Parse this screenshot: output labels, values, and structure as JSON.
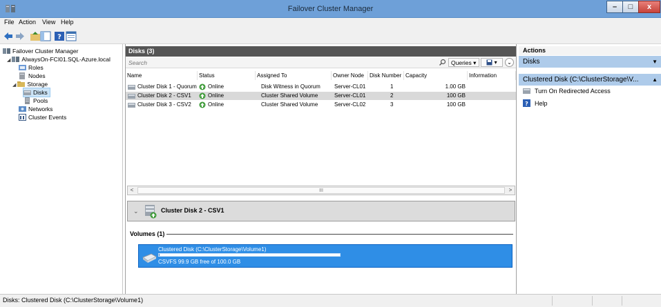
{
  "window": {
    "title": "Failover Cluster Manager",
    "minimize_glyph": "–",
    "maximize_glyph": "□",
    "close_glyph": "x"
  },
  "menu": {
    "items": [
      "File",
      "Action",
      "View",
      "Help"
    ]
  },
  "toolbar": {
    "icons": [
      "back-arrow-icon",
      "forward-arrow-icon",
      "up-folder-icon",
      "show-hide-tree-icon",
      "help-icon",
      "properties-icon"
    ]
  },
  "tree": {
    "root": "Failover Cluster Manager",
    "cluster": "AlwaysOn-FCI01.SQL-Azure.local",
    "roles": "Roles",
    "nodes": "Nodes",
    "storage": "Storage",
    "disks": "Disks",
    "pools": "Pools",
    "networks": "Networks",
    "cluster_events": "Cluster Events"
  },
  "center": {
    "header": "Disks (3)",
    "search_placeholder": "Search",
    "queries_label": "Queries ▾",
    "save_query_label": "▾",
    "collapse_glyph": "⌄",
    "columns": [
      "Name",
      "Status",
      "Assigned To",
      "Owner Node",
      "Disk Number",
      "Capacity",
      "Information"
    ],
    "rows": [
      {
        "name": "Cluster Disk 1 - Quorum",
        "status": "Online",
        "assigned": "Disk Witness in Quorum",
        "owner": "Server-CL01",
        "disk_number": "1",
        "capacity": "1.00 GB",
        "information": ""
      },
      {
        "name": "Cluster Disk 2 - CSV1",
        "status": "Online",
        "assigned": "Cluster Shared Volume",
        "owner": "Server-CL01",
        "disk_number": "2",
        "capacity": "100 GB",
        "information": ""
      },
      {
        "name": "Cluster Disk 3 - CSV2",
        "status": "Online",
        "assigned": "Cluster Shared Volume",
        "owner": "Server-CL02",
        "disk_number": "3",
        "capacity": "100 GB",
        "information": ""
      }
    ],
    "scroll_thumb": "III",
    "scroll_left": "<",
    "scroll_right": ">"
  },
  "detail": {
    "chevron": "⌄",
    "title": "Cluster Disk 2 - CSV1",
    "volumes_label": "Volumes (1)",
    "volume_name": "Clustered Disk (C:\\ClusterStorage\\Volume1)",
    "volume_free": "CSVFS 99.9 GB free of 100.0 GB",
    "volume_used_fraction": 0.001
  },
  "actions": {
    "header": "Actions",
    "section1": "Disks",
    "section2": "Clustered Disk (C:\\ClusterStorage\\V...",
    "caret_down": "▼",
    "caret_up": "▲",
    "item1": "Turn On Redirected Access",
    "item2": "Help"
  },
  "status": {
    "text": "Disks:  Clustered Disk (C:\\ClusterStorage\\Volume1)"
  },
  "colors": {
    "titlebar": "#6ea0d8",
    "selection_tile": "#2f8ee6",
    "action_section": "#aecbea"
  }
}
